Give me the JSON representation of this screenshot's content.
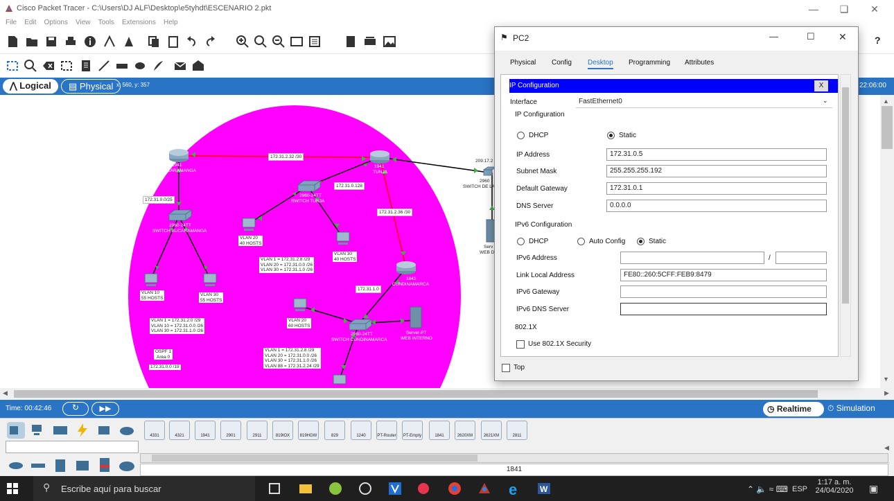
{
  "app": {
    "title": "Cisco Packet Tracer - C:\\Users\\DJ ALF\\Desktop\\e5tyhdt\\ESCENARIO 2.pkt",
    "menu": [
      "File",
      "Edit",
      "Options",
      "View",
      "Tools",
      "Extensions",
      "Help"
    ],
    "help_glyph": "?"
  },
  "workspace": {
    "logical_label": "Logical",
    "physical_label": "Physical",
    "coords": "x: 560, y: 357",
    "clock": "22:06:00"
  },
  "network": {
    "routers": [
      {
        "name": "1941",
        "sub": "BUCARAMANGA"
      },
      {
        "name": "1941",
        "sub": "TUNJA"
      },
      {
        "name": "1841",
        "sub": "CUNDINAMARCA"
      }
    ],
    "switches": [
      {
        "name": "2960-24TT",
        "sub": "SWITCH BUCARAMANGA"
      },
      {
        "name": "2960-24TT",
        "sub": "SWITCH TUNJA"
      },
      {
        "name": "2960-24TT",
        "sub": "SWITCH CUNDINAMARCA"
      },
      {
        "name": "2960",
        "sub": "SWITCH DE LA"
      }
    ],
    "link_labels": [
      "172.31.2.32 /30",
      "172.31.0.128",
      "172.31.2.36 /30",
      "172.31.0.0/25",
      "172.31.1.0",
      "209.17.2"
    ],
    "hosts": [
      {
        "l1": "VLAN 10",
        "l2": "55 HOSTS"
      },
      {
        "l1": "VLAN 30",
        "l2": "55 HOSTS"
      },
      {
        "l1": "VLAN 20",
        "l2": "40 HOSTS"
      },
      {
        "l1": "VLAN 30",
        "l2": "40 HOSTS"
      },
      {
        "l1": "VLAN 20",
        "l2": "60 HOSTS"
      }
    ],
    "vlan_notes": [
      [
        "VLAN 1 = 172.31.2.0 /29",
        "VLAN 10 = 172.31.0.0 /26",
        "VLAN 30 = 172.31.1.0 /26"
      ],
      [
        "VLAN 1 = 172.31.2.8 /29",
        "VLAN 20 = 172.31.0.0 /26",
        "VLAN 30 = 172.31.1.0 /26"
      ],
      [
        "VLAN 1 = 172.31.2.8 /29",
        "VLAN 20 = 172.31.0.0 /26",
        "VLAN 30 = 172.31.1.0 /26",
        "VLAN 88 = 172.31.2.24 /29"
      ]
    ],
    "ospf": [
      "OSPF 1",
      "Area 0"
    ],
    "summary": "172.31.0.0 /19",
    "server": {
      "name": "Server-PT",
      "sub": "WEB INTERNO"
    },
    "server2": {
      "name": "Serv",
      "sub": "WEB D"
    }
  },
  "timebar": {
    "time": "Time: 00:42:46",
    "realtime": "Realtime",
    "simulation": "Simulation"
  },
  "devices": {
    "models": [
      "4331",
      "4321",
      "1941",
      "2901",
      "2911",
      "819IOX",
      "819HGW",
      "829",
      "1240",
      "PT-Router",
      "PT-Empty",
      "1841",
      "2620XM",
      "2621XM",
      "2811"
    ],
    "selected": "1841"
  },
  "pc2": {
    "title": "PC2",
    "tabs": [
      "Physical",
      "Config",
      "Desktop",
      "Programming",
      "Attributes"
    ],
    "active_tab": "Desktop",
    "header": "IP Configuration",
    "close_x": "X",
    "interface_label": "Interface",
    "interface_value": "FastEthernet0",
    "ipv4_group": "IP Configuration",
    "dhcp": "DHCP",
    "static": "Static",
    "ip_label": "IP Address",
    "ip_value": "172.31.0.5",
    "mask_label": "Subnet Mask",
    "mask_value": "255.255.255.192",
    "gw_label": "Default Gateway",
    "gw_value": "172.31.0.1",
    "dns_label": "DNS Server",
    "dns_value": "0.0.0.0",
    "ipv6_group": "IPv6 Configuration",
    "v6_dhcp": "DHCP",
    "v6_auto": "Auto Config",
    "v6_static": "Static",
    "v6_addr_label": "IPv6 Address",
    "v6_slash": "/",
    "v6_ll_label": "Link Local Address",
    "v6_ll_value": "FE80::260:5CFF:FEB9:8479",
    "v6_gw_label": "IPv6 Gateway",
    "v6_dns_label": "IPv6 DNS Server",
    "dot1x_group": "802.1X",
    "dot1x_check": "Use 802.1X Security",
    "top_check": "Top"
  },
  "taskbar": {
    "search": "Escribe aquí para buscar",
    "lang": "ESP",
    "time": "1:17 a. m.",
    "date": "24/04/2020"
  }
}
